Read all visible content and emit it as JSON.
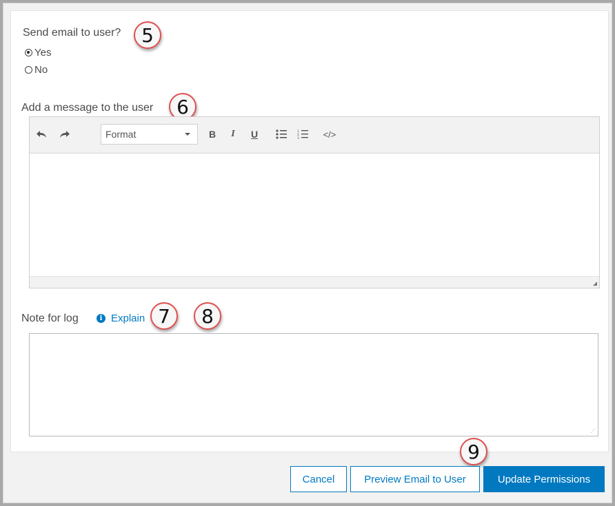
{
  "send_email": {
    "label": "Send email to user?",
    "options": [
      {
        "label": "Yes",
        "checked": true
      },
      {
        "label": "No",
        "checked": false
      }
    ]
  },
  "message": {
    "label": "Add a message to the user",
    "toolbar": {
      "undo_icon": "undo-icon",
      "redo_icon": "redo-icon",
      "format_value": "Format",
      "bold": "B",
      "italic": "I",
      "underline": "U",
      "bullet_list_icon": "bullet-list-icon",
      "numbered_list_icon": "numbered-list-icon",
      "code": "</>"
    }
  },
  "note": {
    "label": "Note for log",
    "explain_label": "Explain"
  },
  "callouts": [
    "5",
    "6",
    "7",
    "8",
    "9"
  ],
  "buttons": {
    "cancel": "Cancel",
    "preview": "Preview Email to User",
    "update": "Update Permissions"
  },
  "colors": {
    "accent": "#0079c1",
    "callout_border": "#e05050"
  }
}
